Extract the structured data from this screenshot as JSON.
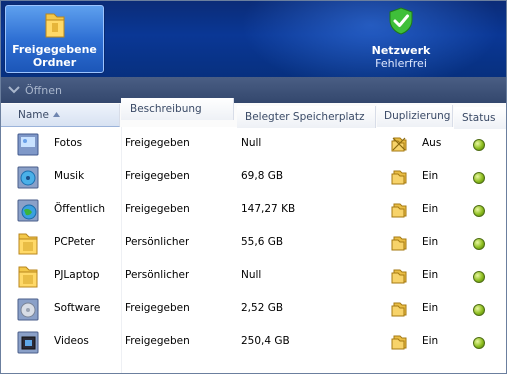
{
  "banner": {
    "shared_folders_label_line1": "Freigegebene",
    "shared_folders_label_line2": "Ordner",
    "network_title": "Netzwerk",
    "network_status": "Fehlerfrei"
  },
  "toolbar": {
    "open_label": "Öffnen"
  },
  "columns": {
    "name": "Name",
    "description": "Beschreibung",
    "used_space": "Belegter Speicherplatz",
    "duplication": "Duplizierung",
    "status": "Status"
  },
  "rows": [
    {
      "name": "Fotos",
      "description": "Freigegebene",
      "used": "Null",
      "dup": "Aus",
      "icon": "photos-folder-icon"
    },
    {
      "name": "Musik",
      "description": "Freigegebene",
      "used": "69,8 GB",
      "dup": "Ein",
      "icon": "music-folder-icon"
    },
    {
      "name": "Öffentlich",
      "description": "Freigegebene",
      "used": "147,27 KB",
      "dup": "Ein",
      "icon": "public-folder-icon"
    },
    {
      "name": "PCPeter",
      "description": "Persönlicher",
      "used": "55,6 GB",
      "dup": "Ein",
      "icon": "folder-icon"
    },
    {
      "name": "PJLaptop",
      "description": "Persönlicher",
      "used": "Null",
      "dup": "Ein",
      "icon": "folder-icon"
    },
    {
      "name": "Software",
      "description": "Freigegebene",
      "used": "2,52 GB",
      "dup": "Ein",
      "icon": "software-folder-icon"
    },
    {
      "name": "Videos",
      "description": "Freigegebene",
      "used": "250,4 GB",
      "dup": "Ein",
      "icon": "videos-folder-icon"
    }
  ],
  "colors": {
    "banner_bg": "#0a3795",
    "selected_button": "#2f70d4",
    "status_ok": "#8dbd1f"
  }
}
